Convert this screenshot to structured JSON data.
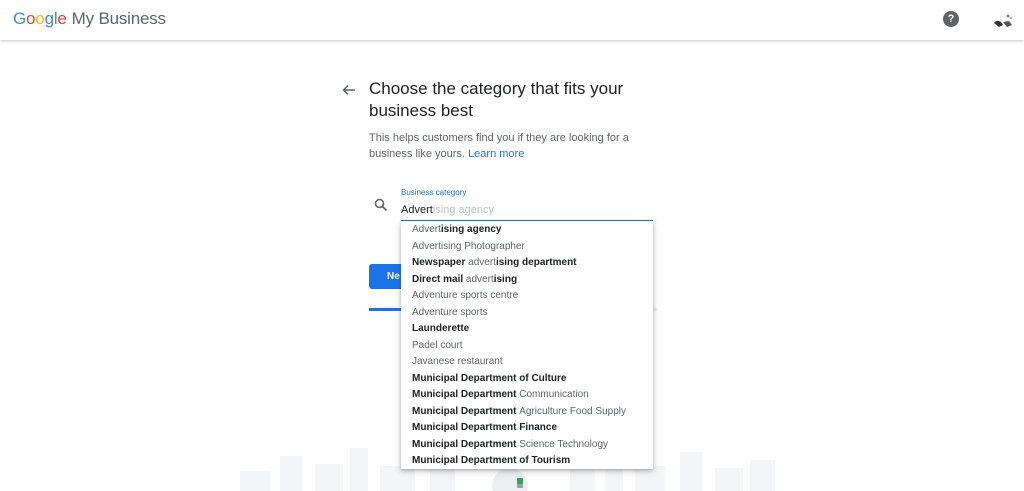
{
  "header": {
    "logo_google": [
      "G",
      "o",
      "o",
      "g",
      "l",
      "e"
    ],
    "product_name": "My Business",
    "help_icon_glyph": "?"
  },
  "page": {
    "title": "Choose the category that fits your business best",
    "subtitle": "This helps customers find you if they are looking for a business like yours.",
    "learn_more": "Learn more"
  },
  "search": {
    "label": "Business category",
    "typed_value": "Advert",
    "autocomplete_hint": "ising agency"
  },
  "next_button": {
    "label": "Ne"
  },
  "progress": {
    "fraction": 0.11
  },
  "suggestions": [
    {
      "parts": [
        {
          "t": "Advert",
          "m": true
        },
        {
          "t": "ising agency",
          "m": false
        }
      ]
    },
    {
      "parts": [
        {
          "t": "Advert",
          "m": true
        },
        {
          "t": "ising Photographer",
          "m": true
        }
      ]
    },
    {
      "parts": [
        {
          "t": "Newspaper ",
          "m": false
        },
        {
          "t": "advert",
          "m": true
        },
        {
          "t": "ising department",
          "m": false
        }
      ]
    },
    {
      "parts": [
        {
          "t": "Direct mail ",
          "m": false
        },
        {
          "t": "advert",
          "m": true
        },
        {
          "t": "ising",
          "m": false
        }
      ]
    },
    {
      "parts": [
        {
          "t": "Adventure sports centre",
          "m": true
        }
      ]
    },
    {
      "parts": [
        {
          "t": "Adventure sports",
          "m": true
        }
      ]
    },
    {
      "parts": [
        {
          "t": "Launderette",
          "m": false
        }
      ]
    },
    {
      "parts": [
        {
          "t": "Padel court",
          "m": true
        }
      ]
    },
    {
      "parts": [
        {
          "t": "Javanese restaurant",
          "m": true
        }
      ]
    },
    {
      "parts": [
        {
          "t": "Municipal Department of Culture",
          "m": false
        }
      ]
    },
    {
      "parts": [
        {
          "t": "Municipal Department ",
          "m": false
        },
        {
          "t": "Communication",
          "m": true
        }
      ]
    },
    {
      "parts": [
        {
          "t": "Municipal Department ",
          "m": false
        },
        {
          "t": "Agriculture Food Supply",
          "m": true
        }
      ]
    },
    {
      "parts": [
        {
          "t": "Municipal Department Finance",
          "m": false
        }
      ]
    },
    {
      "parts": [
        {
          "t": "Municipal Department ",
          "m": false
        },
        {
          "t": "Science Technology",
          "m": true
        }
      ]
    },
    {
      "parts": [
        {
          "t": "Municipal Department of Tourism",
          "m": false
        }
      ]
    }
  ],
  "colors": {
    "accent": "#1a73e8",
    "google_blue": "#4285F4",
    "google_red": "#EA4335",
    "google_yellow": "#FBBC05",
    "google_green": "#34A853"
  },
  "icons": {
    "back": "arrow-back-icon",
    "search": "search-icon",
    "help": "help-icon",
    "avatar": "avatar"
  }
}
